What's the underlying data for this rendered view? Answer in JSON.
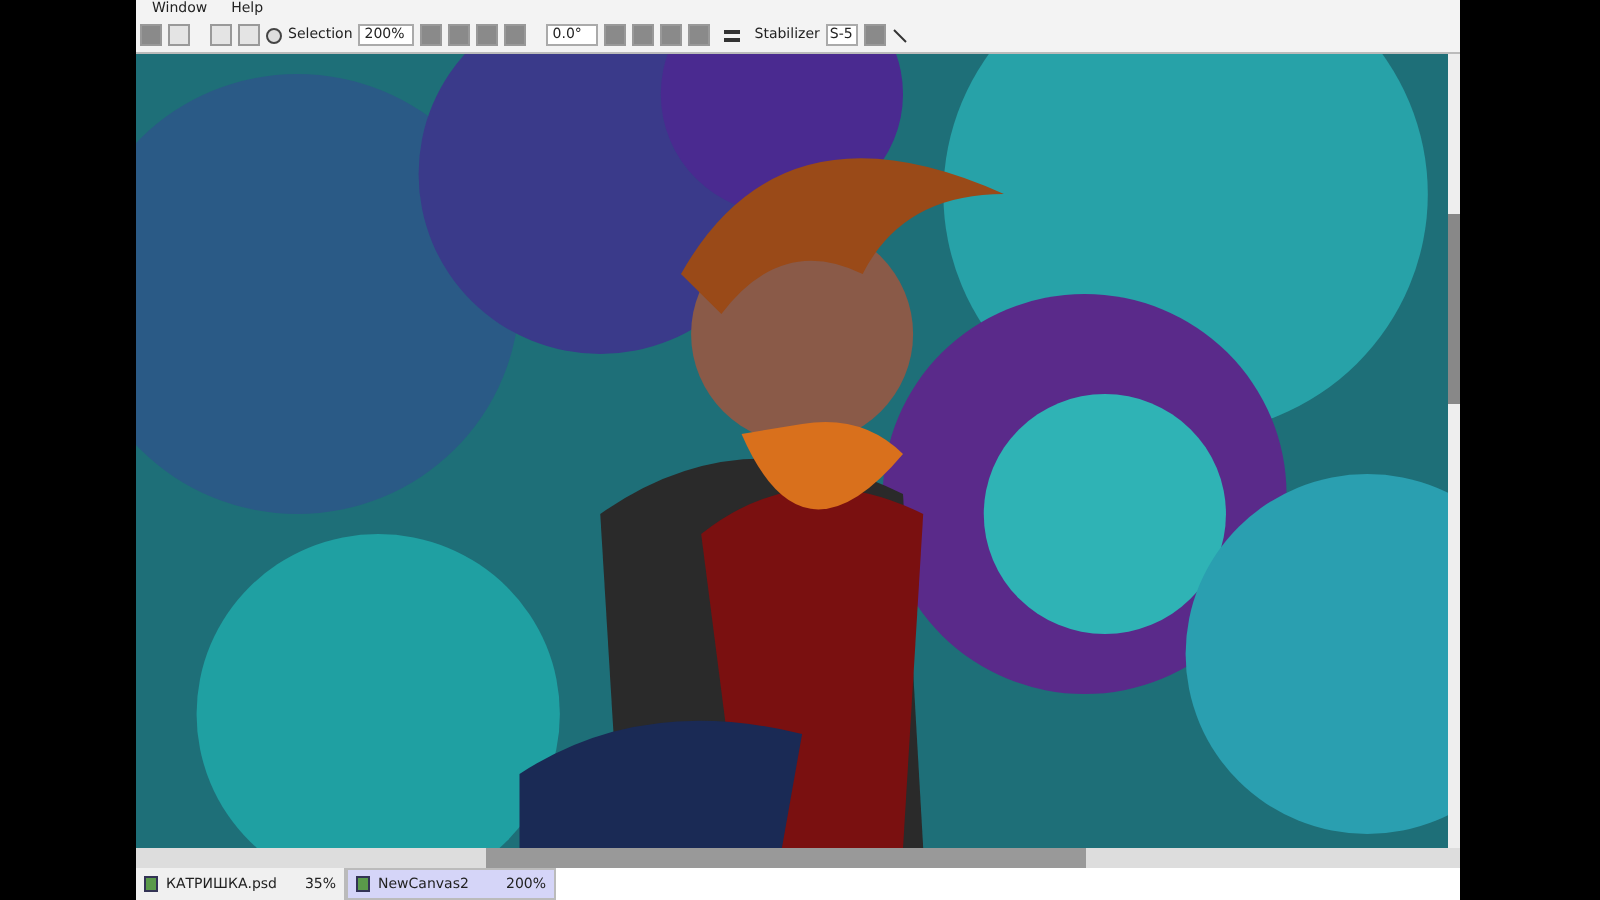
{
  "menu": [
    "Window",
    "Help"
  ],
  "toolbar": {
    "selection_label": "Selection",
    "zoom": "200%",
    "rotation": "0.0°",
    "stabilizer_label": "Stabilizer",
    "stabilizer": "S-5"
  },
  "tabs": [
    {
      "name": "КАТРИШКА.psd",
      "zoom": "35%",
      "selected": false
    },
    {
      "name": "NewCanvas2",
      "zoom": "200%",
      "selected": true
    }
  ]
}
